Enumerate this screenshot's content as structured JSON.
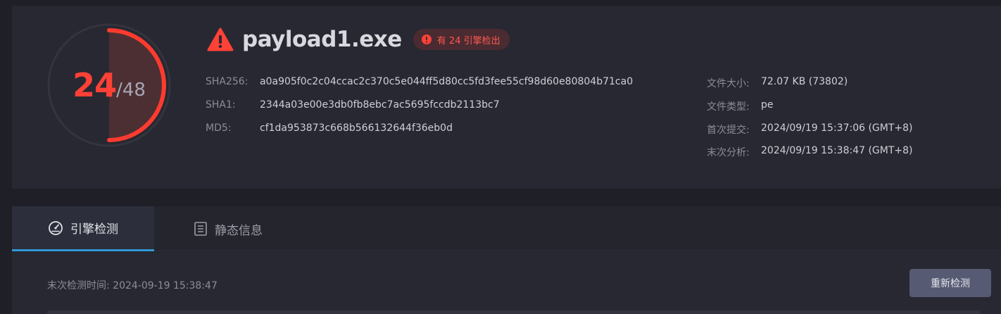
{
  "score": {
    "detected": "24",
    "total": "/48",
    "fraction": 0.5
  },
  "file": {
    "name": "payload1.exe",
    "badge": "有 24 引擎检出"
  },
  "hashes": [
    {
      "label": "SHA256:",
      "value": "a0a905f0c2c04ccac2c370c5e044ff5d80cc5fd3fee55cf98d60e80804b71ca0"
    },
    {
      "label": "SHA1:",
      "value": "2344a03e00e3db0fb8ebc7ac5695fccdb2113bc7"
    },
    {
      "label": "MD5:",
      "value": "cf1da953873c668b566132644f36eb0d"
    }
  ],
  "meta": [
    {
      "label": "文件大小:",
      "value": "72.07 KB (73802)"
    },
    {
      "label": "文件类型:",
      "value": "pe"
    },
    {
      "label": "首次提交:",
      "value": "2024/09/19 15:37:06 (GMT+8)"
    },
    {
      "label": "末次分析:",
      "value": "2024/09/19 15:38:47 (GMT+8)"
    }
  ],
  "tabs": [
    {
      "label": "引擎检测",
      "icon": "gauge-icon"
    },
    {
      "label": "静态信息",
      "icon": "document-list-icon"
    }
  ],
  "panel": {
    "last_check": "末次检测时间: 2024-09-19 15:38:47",
    "recheck_label": "重新检测"
  },
  "colors": {
    "danger": "#ff4136",
    "accent": "#2e9ad6",
    "button": "#575a73"
  }
}
